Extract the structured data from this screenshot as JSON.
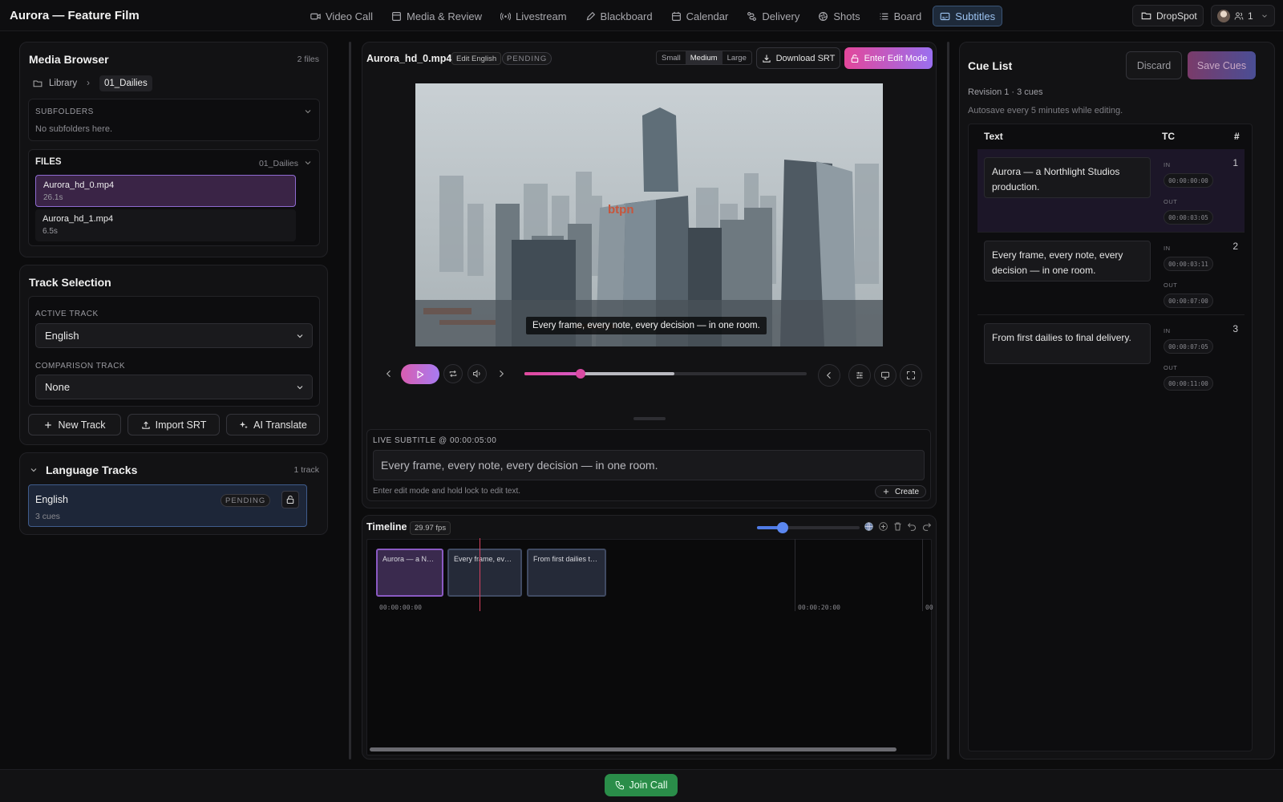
{
  "app": {
    "title": "Aurora — Feature Film"
  },
  "nav": [
    {
      "label": "Video Call",
      "icon": "video-icon"
    },
    {
      "label": "Media & Review",
      "icon": "media-icon"
    },
    {
      "label": "Livestream",
      "icon": "broadcast-icon"
    },
    {
      "label": "Blackboard",
      "icon": "pen-icon"
    },
    {
      "label": "Calendar",
      "icon": "calendar-icon"
    },
    {
      "label": "Delivery",
      "icon": "route-icon"
    },
    {
      "label": "Shots",
      "icon": "aperture-icon"
    },
    {
      "label": "Board",
      "icon": "list-icon"
    },
    {
      "label": "Subtitles",
      "icon": "subtitles-icon",
      "active": true
    }
  ],
  "header_right": {
    "dropspot": "DropSpot",
    "participants": "1"
  },
  "media_browser": {
    "title": "Media Browser",
    "file_count": "2 files",
    "breadcrumb": [
      "Library",
      "01_Dailies"
    ],
    "subfolders_label": "SUBFOLDERS",
    "subfolders_empty": "No subfolders here.",
    "files_label": "FILES",
    "files_folder": "01_Dailies",
    "files": [
      {
        "name": "Aurora_hd_0.mp4",
        "duration": "26.1s",
        "selected": true
      },
      {
        "name": "Aurora_hd_1.mp4",
        "duration": "6.5s",
        "selected": false
      }
    ]
  },
  "track_selection": {
    "title": "Track Selection",
    "active_label": "ACTIVE TRACK",
    "active_value": "English",
    "comparison_label": "COMPARISON TRACK",
    "comparison_value": "None",
    "new_track": "New Track",
    "import_srt": "Import SRT",
    "ai_translate": "AI Translate"
  },
  "language_tracks": {
    "title": "Language Tracks",
    "count": "1 track",
    "items": [
      {
        "name": "English",
        "cues": "3 cues",
        "status": "PENDING"
      }
    ]
  },
  "player": {
    "filename": "Aurora_hd_0.mp4",
    "edit_badge": "Edit English",
    "status": "PENDING",
    "sizes": [
      "Small",
      "Medium",
      "Large"
    ],
    "selected_size": "Medium",
    "download_srt": "Download SRT",
    "enter_edit": "Enter Edit Mode",
    "caption": "Every frame, every note, every decision — in one room.",
    "progress": 0.2,
    "buffered": 0.53
  },
  "live_subtitle": {
    "label": "LIVE SUBTITLE @ 00:00:05:00",
    "text": "Every frame, every note, every decision — in one room.",
    "hint": "Enter edit mode and hold lock to edit text.",
    "create": "Create"
  },
  "timeline": {
    "title": "Timeline",
    "fps": "29.97 fps",
    "zoom": 0.25,
    "clips": [
      "Aurora — a Nort...",
      "Every frame, every...",
      "From first dailies to ..."
    ],
    "ticks": [
      "00:00:00:00",
      "00:00:20:00",
      "00"
    ]
  },
  "cue_list": {
    "title": "Cue List",
    "discard": "Discard",
    "save": "Save Cues",
    "revision": "Revision 1 · 3 cues",
    "autosave": "Autosave every 5 minutes while editing.",
    "col_text": "Text",
    "col_tc": "TC",
    "col_num": "#",
    "in_label": "IN",
    "out_label": "OUT",
    "cues": [
      {
        "num": "1",
        "text": "Aurora — a Northlight Studios production.",
        "in": "00:00:00:00",
        "out": "00:00:03:05"
      },
      {
        "num": "2",
        "text": "Every frame, every note, every decision — in one room.",
        "in": "00:00:03:11",
        "out": "00:00:07:00"
      },
      {
        "num": "3",
        "text": "From first dailies to final delivery.",
        "in": "00:00:07:05",
        "out": "00:00:11:00"
      }
    ]
  },
  "footer": {
    "join_call": "Join Call"
  },
  "colors": {
    "accent": "#d95db0",
    "active_nav": "#9cc2f0",
    "call": "#2a8d49"
  }
}
